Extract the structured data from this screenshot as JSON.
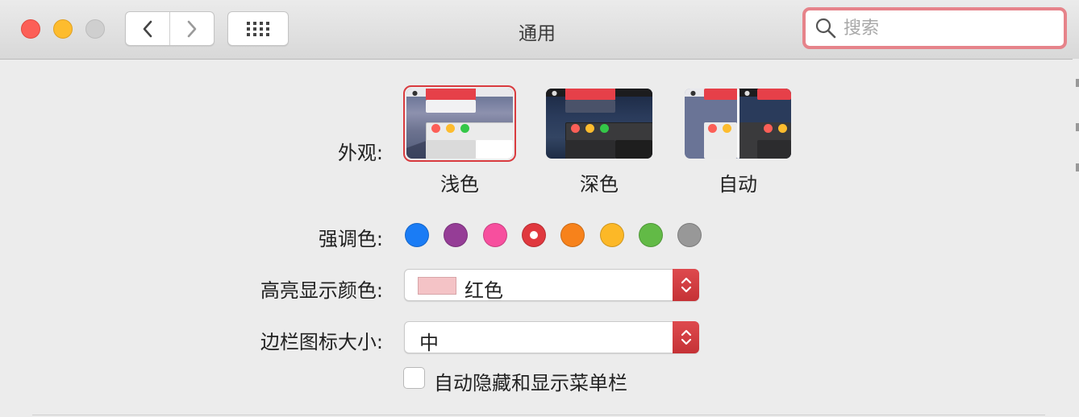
{
  "window": {
    "title": "通用",
    "traffic_lights": [
      "close",
      "minimize",
      "maximize"
    ],
    "nav": {
      "back_icon": "chevron-left-icon",
      "forward_icon": "chevron-right-icon",
      "grid_icon": "grid-icon"
    },
    "search": {
      "placeholder": "搜索",
      "value": "",
      "icon": "search-icon"
    }
  },
  "appearance": {
    "label": "外观:",
    "options": [
      {
        "label": "浅色",
        "selected": true
      },
      {
        "label": "深色",
        "selected": false
      },
      {
        "label": "自动",
        "selected": false
      }
    ]
  },
  "accent_color": {
    "label": "强调色:",
    "colors": [
      "#1a7cf5",
      "#953d96",
      "#f74f9e",
      "#e0383e",
      "#f7821b",
      "#fcb827",
      "#62ba46",
      "#989898"
    ],
    "selected_index": 3
  },
  "highlight_color": {
    "label": "高亮显示颜色:",
    "value": "红色",
    "swatch": "#f4c3c6"
  },
  "sidebar_icon_size": {
    "label": "边栏图标大小:",
    "value": "中"
  },
  "auto_hide_menubar": {
    "label": "自动隐藏和显示菜单栏",
    "checked": false
  },
  "colors": {
    "selection": "#d93b3f",
    "search_focus": "#e6838a",
    "stepper": "#d63f43"
  }
}
